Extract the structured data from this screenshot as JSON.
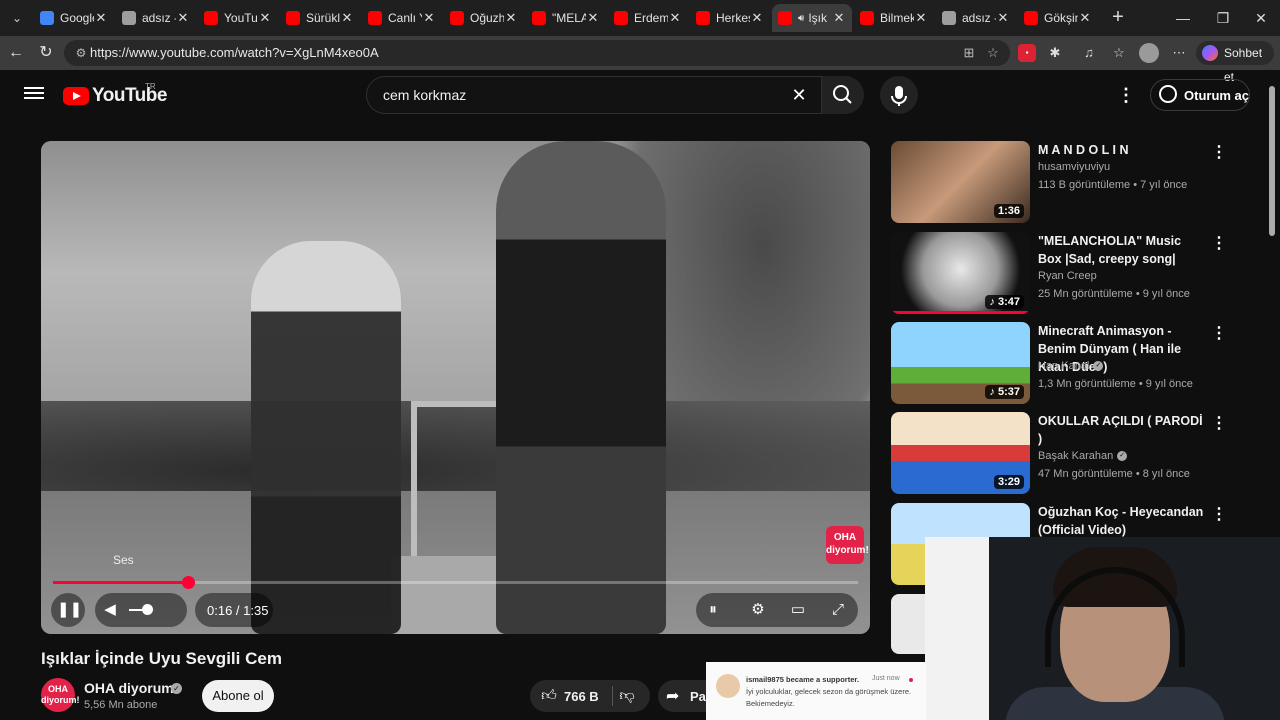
{
  "browser": {
    "tabs": [
      {
        "title": "Google",
        "favicon_color": "#4285f4",
        "active": false
      },
      {
        "title": "adsız - I",
        "favicon_color": "#9e9e9e",
        "active": false
      },
      {
        "title": "YouTub",
        "favicon_color": "#ff0000",
        "active": false
      },
      {
        "title": "Sürükle",
        "favicon_color": "#ff0000",
        "active": false
      },
      {
        "title": "Canlı Ya",
        "favicon_color": "#ff0000",
        "active": false
      },
      {
        "title": "Oğuzha",
        "favicon_color": "#ff0000",
        "active": false
      },
      {
        "title": "\"MELAN",
        "favicon_color": "#ff0000",
        "active": false
      },
      {
        "title": "Erdem A",
        "favicon_color": "#ff0000",
        "active": false
      },
      {
        "title": "Herkes",
        "favicon_color": "#ff0000",
        "active": false
      },
      {
        "title": "Işık",
        "favicon_color": "#ff0000",
        "active": true,
        "audio": true
      },
      {
        "title": "Bilmek",
        "favicon_color": "#ff0000",
        "active": false
      },
      {
        "title": "adsız - I",
        "favicon_color": "#9e9e9e",
        "active": false
      },
      {
        "title": "Gökşin",
        "favicon_color": "#ff0000",
        "active": false
      }
    ],
    "url": "https://www.youtube.com/watch?v=XgLnM4xeo0A",
    "copilot_label": "Sohbet et"
  },
  "youtube": {
    "logo_text": "YouTube",
    "region": "TR",
    "search_value": "cem korkmaz",
    "signin_label": "Oturum aç",
    "accent": "#ff0000"
  },
  "player": {
    "tooltip": "Ses",
    "time": "0:16 / 1:35",
    "progress_fraction": 0.168,
    "watermark": "OHA diyorum!"
  },
  "video": {
    "title": "Işıklar İçinde Uyu Sevgili Cem",
    "channel": "OHA diyorum!",
    "subscribers": "5,56 Mn abone",
    "subscribe_label": "Abone ol",
    "likes": "766 B",
    "share_label": "Pay"
  },
  "recommendations": [
    {
      "title": "M A N D O L I N",
      "channel": "husamviyuviyu",
      "meta": "113 B görüntüleme • 7 yıl önce",
      "duration": "1:36",
      "verified": false,
      "watched_fraction": 0,
      "thumb": "linear-gradient(135deg,#6b4a35,#c69a7a 50%,#3a2a20)"
    },
    {
      "title": "\"MELANCHOLIA\" Music Box |Sad, creepy song|",
      "channel": "Ryan Creep",
      "meta": "25 Mn görüntüleme • 9 yıl önce",
      "duration": "♪ 3:47",
      "verified": false,
      "watched_fraction": 1.0,
      "thumb": "radial-gradient(circle at 50% 45%, #e8e8e8, #9a9a9a 45%, #111 72%)"
    },
    {
      "title": "Minecraft Animasyon - Benim Dünyam ( Han ile Kaan Düet )",
      "channel": "Han Kanal",
      "meta": "1,3 Mn görüntüleme • 9 yıl önce",
      "duration": "♪ 5:37",
      "verified": true,
      "watched_fraction": 0,
      "thumb": "linear-gradient(180deg,#8fd3ff 0 55%,#5fae3a 55% 75%,#7a5a3a 75%)"
    },
    {
      "title": "OKULLAR AÇILDI ( PARODİ )",
      "channel": "Başak Karahan",
      "meta": "47 Mn görüntüleme • 8 yıl önce",
      "duration": "3:29",
      "verified": true,
      "watched_fraction": 0,
      "thumb": "linear-gradient(180deg,#f3e1c8 0 40%,#d93b3b 40% 60%,#2a6bd1 60%)"
    },
    {
      "title": "Oğuzhan Koç - Heyecandan (Official Video)",
      "channel": "",
      "meta": "",
      "duration": "",
      "verified": false,
      "watched_fraction": 0,
      "thumb": "linear-gradient(180deg,#bfe3ff 0 50%,#e6d35a 50%)"
    }
  ],
  "notification": {
    "headline": "ismail9875 became a supporter.",
    "when": "Just now",
    "message": "İyi yolculuklar, gelecek sezon da görüşmek üzere. Bekiemedeyiz."
  },
  "icons": {
    "menu": "hamburger-icon",
    "search": "search-icon",
    "mic": "microphone-icon",
    "settings": "gear-icon",
    "fullscreen": "fullscreen-icon"
  }
}
